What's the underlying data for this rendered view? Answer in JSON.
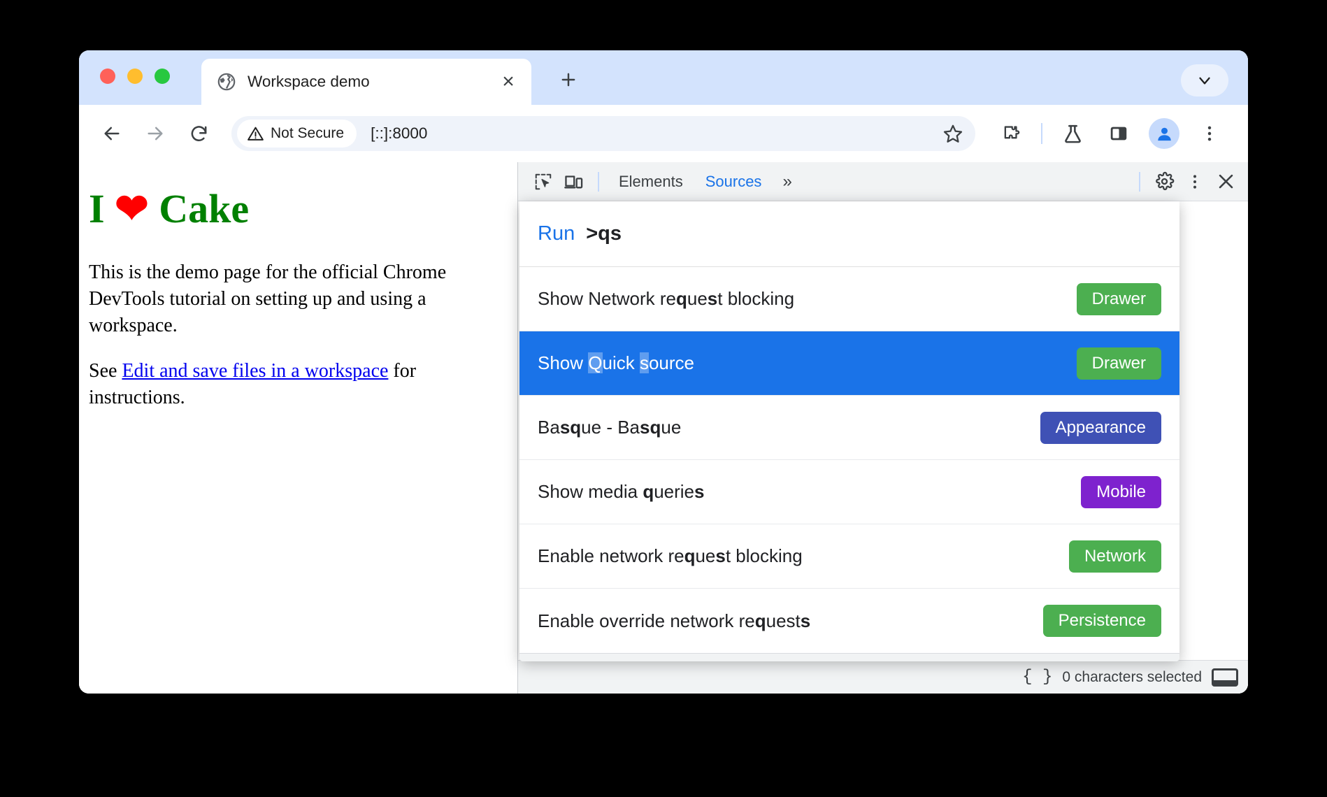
{
  "window": {
    "traffic_lights": [
      "close",
      "minimize",
      "maximize"
    ]
  },
  "tabstrip": {
    "tab_title": "Workspace demo",
    "favicon_name": "globe-icon",
    "close_label": "×",
    "new_tab_label": "+",
    "chevron_label": "˅"
  },
  "toolbar": {
    "back_label": "←",
    "forward_label": "→",
    "reload_label": "↻",
    "security_chip": "Not Secure",
    "url": "[::]:8000",
    "bookmark_name": "star-icon",
    "extensions_name": "puzzle-piece-icon",
    "experiments_name": "flask-icon",
    "side_panel_name": "side-panel-icon",
    "profile_name": "profile-avatar-icon",
    "menu_label": "⋮"
  },
  "page": {
    "heading_before": "I ",
    "heading_heart": "❤",
    "heading_after": " Cake",
    "paragraph1": "This is the demo page for the official Chrome DevTools tutorial on setting up and using a workspace.",
    "para2_prefix": "See ",
    "para2_link": "Edit and save files in a workspace",
    "para2_suffix": " for instructions."
  },
  "devtools": {
    "inspect_icon_name": "inspect-element-icon",
    "device_icon_name": "device-toolbar-icon",
    "tabs": [
      {
        "label": "Elements",
        "active": false
      },
      {
        "label": "Sources",
        "active": true
      }
    ],
    "more_tabs_label": "»",
    "settings_name": "gear-icon",
    "kebab_label": "⋮",
    "close_label": "✕",
    "status_bar": {
      "pretty_print_label": "{ }",
      "text": "0 characters selected",
      "drawer_toggle_name": "drawer-toggle-icon"
    }
  },
  "command_menu": {
    "prefix": "Run",
    "query": ">qs",
    "rows": [
      {
        "parts": [
          {
            "t": "Show Network re",
            "b": false
          },
          {
            "t": "q",
            "b": true
          },
          {
            "t": "ue",
            "b": false
          },
          {
            "t": "s",
            "b": true
          },
          {
            "t": "t blocking",
            "b": false
          }
        ],
        "badge": "Drawer",
        "badge_color": "#4caf50",
        "selected": false
      },
      {
        "parts": [
          {
            "t": "Show ",
            "b": false
          },
          {
            "t": "Q",
            "b": true
          },
          {
            "t": "uick ",
            "b": false
          },
          {
            "t": "s",
            "b": true
          },
          {
            "t": "ource",
            "b": false
          }
        ],
        "badge": "Drawer",
        "badge_color": "#4caf50",
        "selected": true
      },
      {
        "parts": [
          {
            "t": "Ba",
            "b": false
          },
          {
            "t": "s",
            "b": true
          },
          {
            "t": "q",
            "b": true
          },
          {
            "t": "ue - Ba",
            "b": false
          },
          {
            "t": "s",
            "b": true
          },
          {
            "t": "q",
            "b": true
          },
          {
            "t": "ue",
            "b": false
          }
        ],
        "badge": "Appearance",
        "badge_color": "#3f51b5",
        "selected": false
      },
      {
        "parts": [
          {
            "t": "Show media ",
            "b": false
          },
          {
            "t": "q",
            "b": true
          },
          {
            "t": "uerie",
            "b": false
          },
          {
            "t": "s",
            "b": true
          }
        ],
        "badge": "Mobile",
        "badge_color": "#7e22ce",
        "selected": false
      },
      {
        "parts": [
          {
            "t": "Enable network re",
            "b": false
          },
          {
            "t": "q",
            "b": true
          },
          {
            "t": "ue",
            "b": false
          },
          {
            "t": "s",
            "b": true
          },
          {
            "t": "t blocking",
            "b": false
          }
        ],
        "badge": "Network",
        "badge_color": "#4caf50",
        "selected": false
      },
      {
        "parts": [
          {
            "t": "Enable override network re",
            "b": false
          },
          {
            "t": "q",
            "b": true
          },
          {
            "t": "ue",
            "b": false
          },
          {
            "t": "st",
            "b": false
          },
          {
            "t": "s",
            "b": true
          }
        ],
        "badge": "Persistence",
        "badge_color": "#4caf50",
        "selected": false
      }
    ]
  },
  "colors": {
    "tab_strip_bg": "#d3e3fd",
    "accent_blue": "#1a73e8",
    "heading_green": "#008000",
    "link_blue": "#0000ee"
  }
}
